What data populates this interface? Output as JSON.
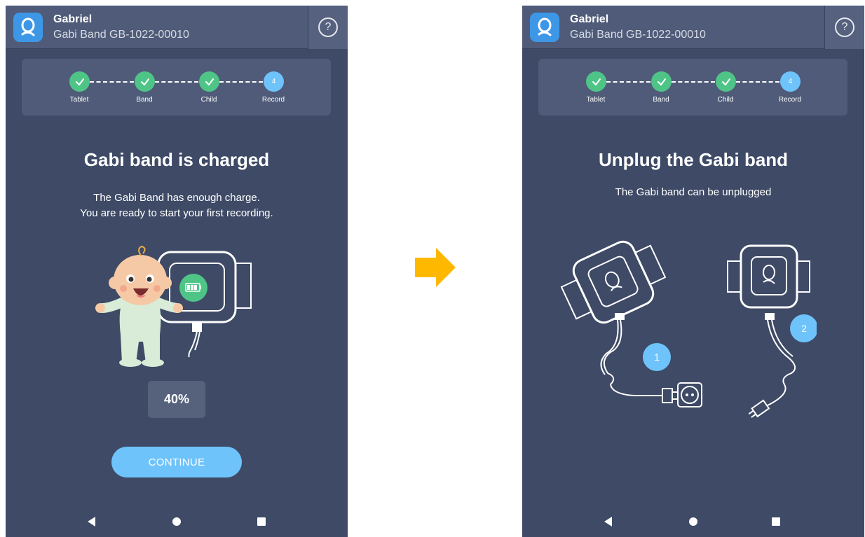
{
  "colors": {
    "screen_bg": "#3e4a66",
    "header_bg": "#4f5b78",
    "step_done": "#4fc487",
    "step_current": "#6ec3fb",
    "accent_button": "#6ec3fb",
    "flow_arrow": "#ffb800"
  },
  "flow_arrow_icon": "arrow-right-icon",
  "screens": [
    {
      "header": {
        "name": "Gabriel",
        "device": "Gabi Band GB-1022-00010",
        "help_label": "?"
      },
      "steps": [
        {
          "label": "Tablet",
          "state": "done"
        },
        {
          "label": "Band",
          "state": "done"
        },
        {
          "label": "Child",
          "state": "done"
        },
        {
          "label": "Record",
          "state": "current",
          "number": "4"
        }
      ],
      "title": "Gabi band is charged",
      "description_line1": "The Gabi Band has enough charge.",
      "description_line2": "You are ready to start your first recording.",
      "charge_percent": "40%",
      "continue_label": "CONTINUE"
    },
    {
      "header": {
        "name": "Gabriel",
        "device": "Gabi Band GB-1022-00010",
        "help_label": "?"
      },
      "steps": [
        {
          "label": "Tablet",
          "state": "done"
        },
        {
          "label": "Band",
          "state": "done"
        },
        {
          "label": "Child",
          "state": "done"
        },
        {
          "label": "Record",
          "state": "current",
          "number": "4"
        }
      ],
      "title": "Unplug the Gabi band",
      "description": "The Gabi band can be unplugged",
      "instruction_badges": [
        "1",
        "2"
      ]
    }
  ]
}
